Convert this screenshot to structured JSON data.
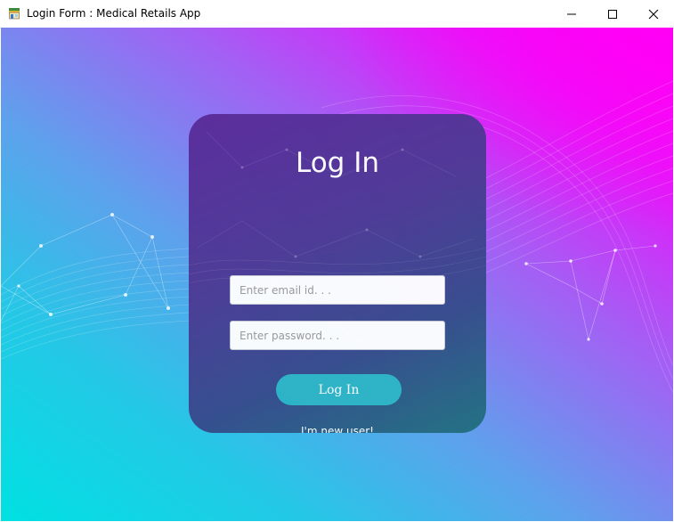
{
  "window": {
    "title": "Login Form : Medical Retails App",
    "app_icon": "store-icon",
    "controls": [
      "minimize-icon",
      "maximize-icon",
      "close-icon"
    ]
  },
  "login_card": {
    "heading": "Log In",
    "email_field": {
      "value": "",
      "placeholder": "Enter email id. . ."
    },
    "password_field": {
      "value": "",
      "placeholder": "Enter password. . ."
    },
    "login_button_label": "Log In",
    "new_user_link": "I'm new user!"
  },
  "colors": {
    "background_gradient": [
      "#00e1e2",
      "#5ea1ec",
      "#a55ef4",
      "#ff00f5"
    ],
    "card": "#4d3a95",
    "button": "#2db4c6"
  }
}
